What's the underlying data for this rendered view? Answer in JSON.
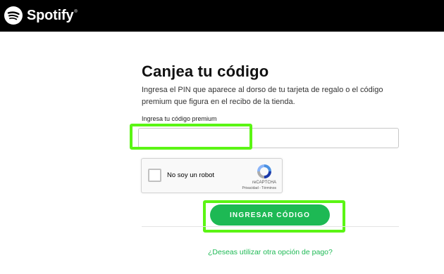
{
  "header": {
    "brand_name": "Spotify",
    "brand_mark": "®"
  },
  "page": {
    "title": "Canjea tu código",
    "description": "Ingresa el PIN que aparece al dorso de tu tarjeta de regalo o el código premium que figura en el recibo de la tienda."
  },
  "form": {
    "code_label": "Ingresa tu código premium",
    "code_value": "",
    "submit_label": "INGRESAR CÓDIGO"
  },
  "recaptcha": {
    "checkbox_label": "No soy un robot",
    "brand": "reCAPTCHA",
    "privacy": "Privacidad",
    "separator": " - ",
    "terms": "Términos"
  },
  "footer": {
    "alt_payment_link": "¿Deseas utilizar otra opción de pago?"
  },
  "colors": {
    "accent": "#1db954",
    "highlight": "#5bf514",
    "header_bg": "#000000"
  }
}
